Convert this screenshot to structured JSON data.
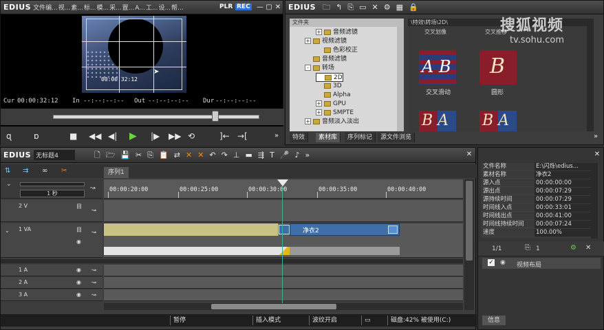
{
  "watermark": {
    "brand": "搜狐视频",
    "url": "tv.sohu.com"
  },
  "player": {
    "app": "EDIUS",
    "menu": [
      "文件编...",
      "视...",
      "素...",
      "标...",
      "模...",
      "采...",
      "置...",
      "A...",
      "工...",
      "设...",
      "帮..."
    ],
    "plr": "PLR",
    "rec": "REC",
    "overlay_timecode": "00:00:32:12",
    "cur_label": "Cur",
    "cur_value": "00:00:32:12",
    "in_label": "In",
    "in_value": "--:--:--:--",
    "out_label": "Out",
    "out_value": "--:--:--:--",
    "dur_label": "Dur",
    "dur_value": "--:--:--:--"
  },
  "library": {
    "app": "EDIUS",
    "tree_header": "文件夹",
    "path": "\\特效\\转场\\2D\\",
    "tree": [
      {
        "label": "音频滤镜",
        "exp": "+"
      },
      {
        "label": "视频滤镜",
        "exp": "+"
      },
      {
        "label": "色彩校正",
        "exp": ""
      },
      {
        "label": "音频滤镜",
        "exp": ""
      },
      {
        "label": "转场",
        "exp": "-"
      },
      {
        "label": "2D",
        "exp": ""
      },
      {
        "label": "3D",
        "exp": ""
      },
      {
        "label": "Alpha",
        "exp": ""
      },
      {
        "label": "GPU",
        "exp": "+"
      },
      {
        "label": "SMPTE",
        "exp": "+"
      },
      {
        "label": "音频淡入淡出",
        "exp": "+"
      }
    ],
    "top_labels": [
      "交叉划像",
      "交叉推移"
    ],
    "items": [
      {
        "label": "交叉滑动",
        "glyph": "A B"
      },
      {
        "label": "圆形",
        "glyph": "B"
      },
      {
        "label": "",
        "glyph": "B A"
      },
      {
        "label": "",
        "glyph": "B A"
      }
    ],
    "tabs": [
      "特效",
      "素材库",
      "序列标记",
      "源文件浏览"
    ]
  },
  "timeline": {
    "app": "EDIUS",
    "project": "无标题4",
    "sequence_tab": "序列1",
    "scale": "1 秒",
    "ruler": [
      "00:00:20:00",
      "00:00:25:00",
      "00:00:30:00",
      "00:00:35:00",
      "00:00:40:00"
    ],
    "tracks": [
      {
        "name": "2 V"
      },
      {
        "name": "1 VA"
      },
      {
        "name": "1 A"
      },
      {
        "name": "2 A"
      },
      {
        "name": "3 A"
      }
    ],
    "clip_name": "净衣2",
    "status": [
      "暂停",
      "插入模式",
      "波纹开启",
      "",
      "磁盘:42% 被使用(C:)"
    ]
  },
  "info": {
    "rows": [
      {
        "key": "文件名称",
        "value": "E:\\闪烁\\edius..."
      },
      {
        "key": "素材名称",
        "value": "净衣2"
      },
      {
        "key": "源入点",
        "value": "00:00:00:00"
      },
      {
        "key": "源出点",
        "value": "00:00:07:29"
      },
      {
        "key": "源持续时间",
        "value": "00:00:07:29"
      },
      {
        "key": "时间线入点",
        "value": "00:00:33:01"
      },
      {
        "key": "时间线出点",
        "value": "00:00:41:00"
      },
      {
        "key": "时间线持续时间",
        "value": "00:00:07:24"
      },
      {
        "key": "速度",
        "value": "100.00%"
      }
    ],
    "page": "1/1",
    "count": "1",
    "layer": "视频布局",
    "tab": "信息"
  },
  "colors": {
    "rec": "#2d6fd6",
    "clip": "#c9c283",
    "transition_clip": "#3e6fa8",
    "cursor": "#3ab0a0",
    "play": "#6ed23a"
  }
}
